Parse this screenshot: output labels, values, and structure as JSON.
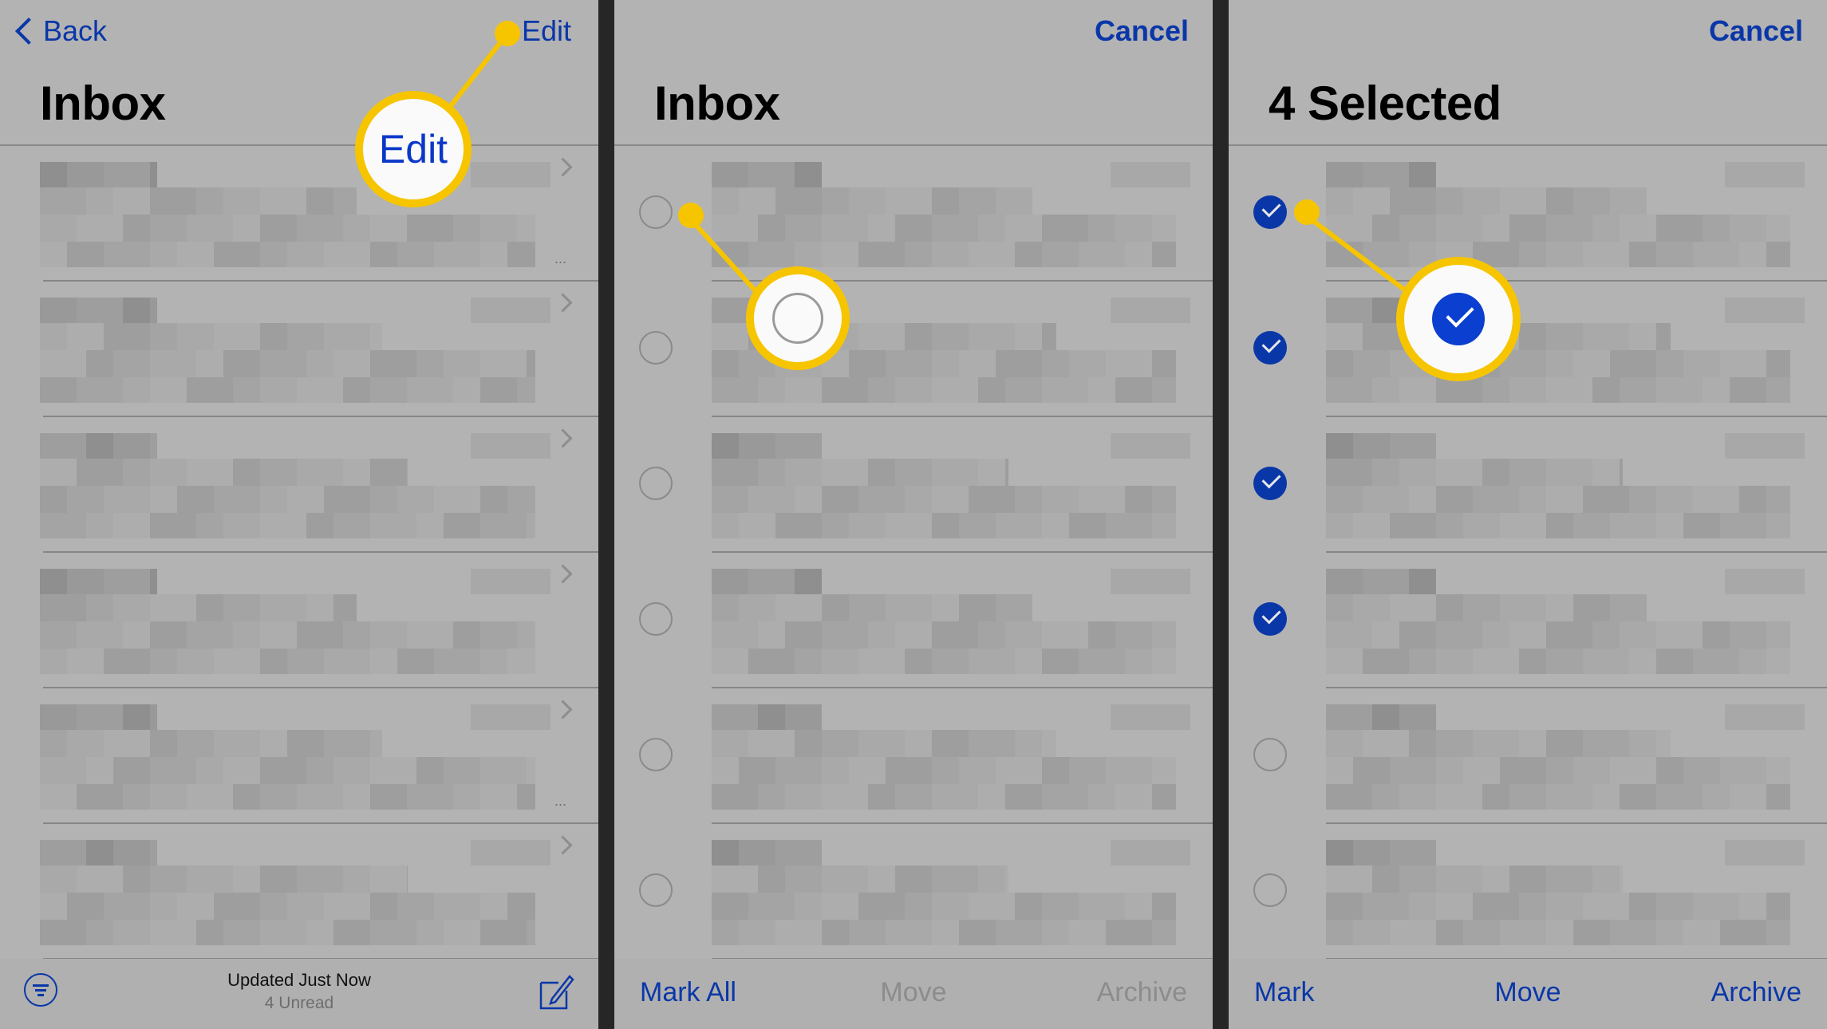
{
  "colors": {
    "accent_blue": "#0a37a8",
    "highlight_yellow": "#f6c500",
    "panel_bg": "#b3b3b3",
    "divider": "#262626",
    "disabled_text": "#8c8c8c"
  },
  "panels": [
    {
      "id": "inbox-normal",
      "nav": {
        "back_label": "Back",
        "right_label": "Edit"
      },
      "title": "Inbox",
      "callout": {
        "label": "Edit",
        "target": "edit-button"
      },
      "rows": [
        {
          "content": "pixelated-email",
          "has_chevron": true,
          "has_ellipsis": true
        },
        {
          "content": "pixelated-email",
          "has_chevron": true,
          "has_ellipsis": false
        },
        {
          "content": "pixelated-email",
          "has_chevron": true,
          "has_ellipsis": false
        },
        {
          "content": "pixelated-email",
          "has_chevron": true,
          "has_ellipsis": false
        },
        {
          "content": "pixelated-email",
          "has_chevron": true,
          "has_ellipsis": true
        },
        {
          "content": "pixelated-email",
          "has_chevron": true,
          "has_ellipsis": false
        }
      ],
      "footer": {
        "filter_icon": "filter-icon",
        "status": "Updated Just Now",
        "substatus": "4 Unread",
        "compose_icon": "compose-icon"
      }
    },
    {
      "id": "inbox-edit",
      "nav": {
        "right_label": "Cancel"
      },
      "title": "Inbox",
      "callout": {
        "target": "selection-circle",
        "state": "unselected"
      },
      "rows": [
        {
          "selected": false
        },
        {
          "selected": false
        },
        {
          "selected": false
        },
        {
          "selected": false
        },
        {
          "selected": false
        },
        {
          "selected": false
        }
      ],
      "footer": {
        "buttons": [
          {
            "label": "Mark All",
            "enabled": true
          },
          {
            "label": "Move",
            "enabled": false
          },
          {
            "label": "Archive",
            "enabled": false
          }
        ]
      }
    },
    {
      "id": "inbox-selected",
      "nav": {
        "right_label": "Cancel"
      },
      "title": "4 Selected",
      "selected_count": 4,
      "callout": {
        "target": "selection-circle",
        "state": "selected"
      },
      "rows": [
        {
          "selected": true
        },
        {
          "selected": true
        },
        {
          "selected": true
        },
        {
          "selected": true
        },
        {
          "selected": false
        },
        {
          "selected": false
        }
      ],
      "footer": {
        "buttons": [
          {
            "label": "Mark",
            "enabled": true
          },
          {
            "label": "Move",
            "enabled": true
          },
          {
            "label": "Archive",
            "enabled": true
          }
        ]
      }
    }
  ]
}
